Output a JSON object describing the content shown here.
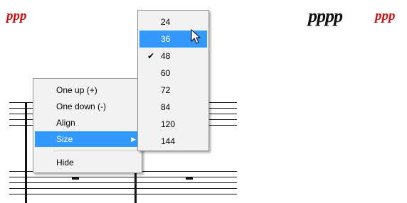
{
  "dynamics": {
    "left_red": "ppp",
    "right_black": "pppp",
    "right_red": "ppp"
  },
  "context_menu": {
    "items": [
      {
        "label": "One up (+)"
      },
      {
        "label": "One down (-)"
      },
      {
        "label": "Align"
      },
      {
        "label": "Size",
        "highlighted": true,
        "submenu_arrow": "chevron-right-icon"
      },
      {
        "label": "Hide"
      }
    ]
  },
  "size_submenu": {
    "options": [
      {
        "label": "24"
      },
      {
        "label": "36",
        "highlighted": true
      },
      {
        "label": "48",
        "checked": true
      },
      {
        "label": "60"
      },
      {
        "label": "72"
      },
      {
        "label": "84"
      },
      {
        "label": "120"
      },
      {
        "label": "144"
      }
    ]
  },
  "colors": {
    "highlight": "#3399ff",
    "dynamics_red": "#cc1111",
    "menu_bg": "#f2f2f2"
  }
}
